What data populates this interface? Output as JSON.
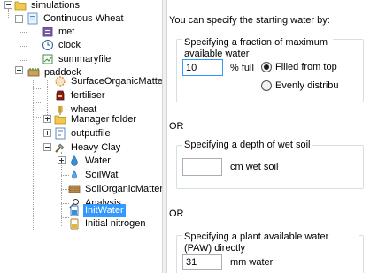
{
  "tree": {
    "items": [
      {
        "label": "simulations",
        "icon": "folder-icon"
      },
      {
        "label": "Continuous Wheat",
        "icon": "simulation-icon"
      },
      {
        "label": "met",
        "icon": "met-icon"
      },
      {
        "label": "clock",
        "icon": "clock-icon"
      },
      {
        "label": "summaryfile",
        "icon": "summaryfile-icon"
      },
      {
        "label": "paddock",
        "icon": "paddock-icon"
      },
      {
        "label": "SurfaceOrganicMatte",
        "icon": "surface-organic-matter-icon"
      },
      {
        "label": "fertiliser",
        "icon": "fertiliser-icon"
      },
      {
        "label": "wheat",
        "icon": "wheat-icon"
      },
      {
        "label": "Manager folder",
        "icon": "folder-icon"
      },
      {
        "label": "outputfile",
        "icon": "outputfile-icon"
      },
      {
        "label": "Heavy Clay",
        "icon": "soil-icon"
      },
      {
        "label": "Water",
        "icon": "water-icon"
      },
      {
        "label": "SoilWat",
        "icon": "soilwat-icon"
      },
      {
        "label": "SoilOrganicMatter",
        "icon": "soil-organic-matter-icon"
      },
      {
        "label": "Analysis",
        "icon": "analysis-icon"
      },
      {
        "label": "InitWater",
        "icon": "init-water-icon"
      },
      {
        "label": "Initial nitrogen",
        "icon": "initial-nitrogen-icon"
      }
    ]
  },
  "form": {
    "intro": "You can specify the starting water by:",
    "fraction_group": {
      "title": "Specifying a fraction of maximum available water",
      "value": "10",
      "unit": "% full",
      "radio_top": "Filled from top",
      "radio_even": "Evenly distribu"
    },
    "or_1": "OR",
    "depth_group": {
      "title": "Specifying a depth of wet soil",
      "value": "",
      "unit": "cm wet soil"
    },
    "or_2": "OR",
    "paw_group": {
      "title": "Specifying a plant available water (PAW) directly",
      "value": "31",
      "unit": "mm water"
    }
  },
  "colors": {
    "selection": "#3399ff",
    "group_border": "#d5dfe5"
  }
}
